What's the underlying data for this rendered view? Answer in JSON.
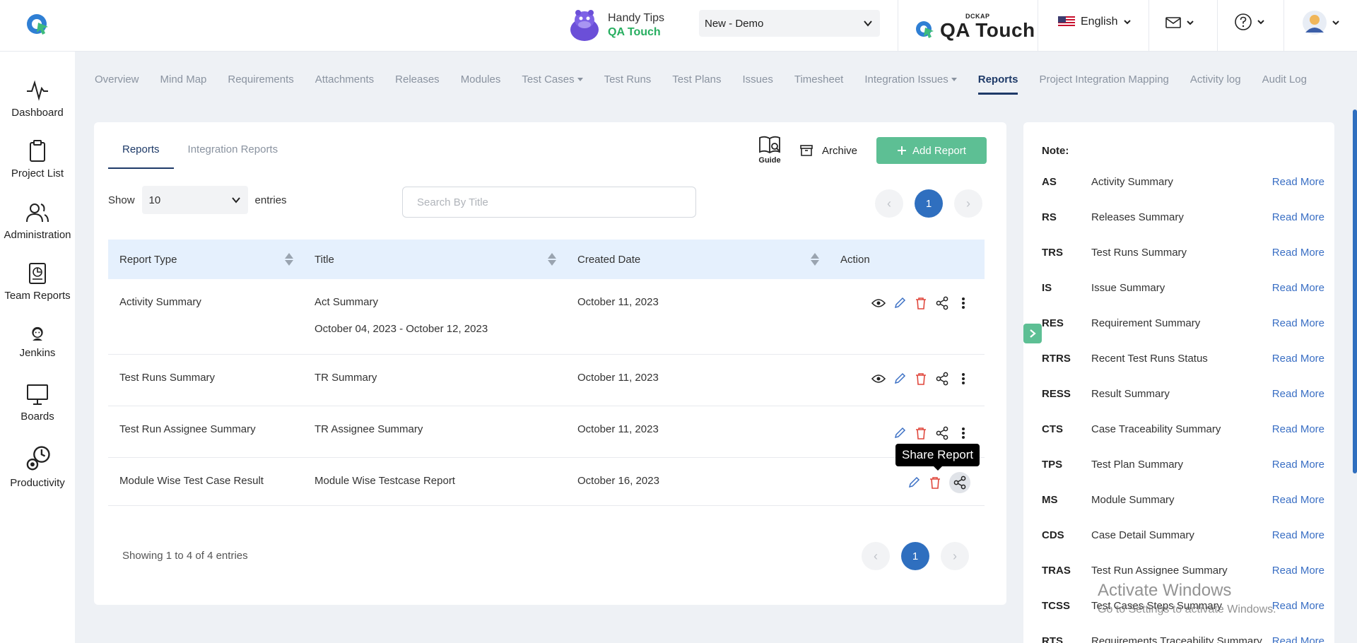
{
  "header": {
    "handy_tips_title": "Handy Tips",
    "handy_tips_sub": "QA Touch",
    "project_select_value": "New - Demo",
    "brand_small": "DCKAP",
    "brand_big": "QA Touch",
    "language": "English"
  },
  "sidebar": {
    "items": [
      {
        "label": "Dashboard"
      },
      {
        "label": "Project List"
      },
      {
        "label": "Administration"
      },
      {
        "label": "Team Reports"
      },
      {
        "label": "Jenkins"
      },
      {
        "label": "Boards"
      },
      {
        "label": "Productivity"
      }
    ]
  },
  "nav": {
    "items": [
      {
        "label": "Overview"
      },
      {
        "label": "Mind Map"
      },
      {
        "label": "Requirements"
      },
      {
        "label": "Attachments"
      },
      {
        "label": "Releases"
      },
      {
        "label": "Modules"
      },
      {
        "label": "Test Cases"
      },
      {
        "label": "Test Runs"
      },
      {
        "label": "Test Plans"
      },
      {
        "label": "Issues"
      },
      {
        "label": "Timesheet"
      },
      {
        "label": "Integration Issues"
      },
      {
        "label": "Reports"
      },
      {
        "label": "Project Integration Mapping"
      },
      {
        "label": "Activity log"
      },
      {
        "label": "Audit Log"
      }
    ]
  },
  "main": {
    "tabs": [
      {
        "label": "Reports"
      },
      {
        "label": "Integration Reports"
      }
    ],
    "guide_label": "Guide",
    "archive_label": "Archive",
    "add_report_label": "Add Report",
    "show_label": "Show",
    "entries_value": "10",
    "entries_label": "entries",
    "search_placeholder": "Search By Title",
    "current_page": "1",
    "table": {
      "headers": [
        "Report Type",
        "Title",
        "Created Date",
        "Action"
      ],
      "rows": [
        {
          "type": "Activity Summary",
          "title": "Act Summary",
          "subtitle": "October 04, 2023 - October 12, 2023",
          "date": "October 11, 2023"
        },
        {
          "type": "Test Runs Summary",
          "title": "TR Summary",
          "date": "October 11, 2023"
        },
        {
          "type": "Test Run Assignee Summary",
          "title": "TR Assignee Summary",
          "date": "October 11, 2023"
        },
        {
          "type": "Module Wise Test Case Result",
          "title": "Module Wise Testcase Report",
          "date": "October 16, 2023"
        }
      ]
    },
    "tooltip": "Share Report",
    "showing_text": "Showing 1 to 4 of 4 entries"
  },
  "note": {
    "title": "Note:",
    "read_more": "Read More",
    "items": [
      {
        "abbr": "AS",
        "name": "Activity Summary"
      },
      {
        "abbr": "RS",
        "name": "Releases Summary"
      },
      {
        "abbr": "TRS",
        "name": "Test Runs Summary"
      },
      {
        "abbr": "IS",
        "name": "Issue Summary"
      },
      {
        "abbr": "RES",
        "name": "Requirement Summary"
      },
      {
        "abbr": "RTRS",
        "name": "Recent Test Runs Status"
      },
      {
        "abbr": "RESS",
        "name": "Result Summary"
      },
      {
        "abbr": "CTS",
        "name": "Case Traceability Summary"
      },
      {
        "abbr": "TPS",
        "name": "Test Plan Summary"
      },
      {
        "abbr": "MS",
        "name": "Module Summary"
      },
      {
        "abbr": "CDS",
        "name": "Case Detail Summary"
      },
      {
        "abbr": "TRAS",
        "name": "Test Run Assignee Summary"
      },
      {
        "abbr": "TCSS",
        "name": "Test Cases Steps Summary"
      },
      {
        "abbr": "RTS",
        "name": "Requirements Traceability Summary"
      }
    ]
  },
  "watermark": {
    "title": "Activate Windows",
    "sub": "Go to Settings to activate Windows."
  },
  "colors": {
    "accent": "#2f6fbf",
    "primary_button": "#5dbf94",
    "link": "#3a6fc4",
    "delete": "#e0473c",
    "table_header": "#e5f0fd"
  }
}
